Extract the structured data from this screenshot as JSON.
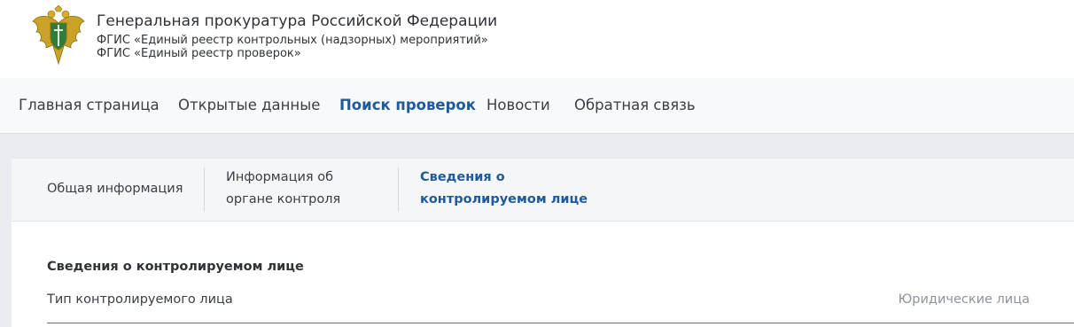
{
  "header": {
    "org_title": "Генеральная прокуратура Российской Федерации",
    "subtitle_1": "ФГИС «Единый реестр контрольных (надзорных) мероприятий»",
    "subtitle_2": "ФГИС «Единый реестр проверок»",
    "emblem_icon": "prosecutor-emblem-icon"
  },
  "nav": {
    "items": [
      {
        "label": "Главная страница",
        "active": false
      },
      {
        "label": "Открытые данные",
        "active": false
      },
      {
        "label": "Поиск проверок",
        "active": true
      },
      {
        "label": "Новости",
        "active": false
      },
      {
        "label": "Обратная связь",
        "active": false
      }
    ]
  },
  "tabs": {
    "items": [
      {
        "line1": "Общая информация",
        "line2": "",
        "active": false
      },
      {
        "line1": "Информация об",
        "line2": "органе контроля",
        "active": false
      },
      {
        "line1": "Сведения о",
        "line2": "контролируемом лице",
        "active": true
      }
    ]
  },
  "section": {
    "title": "Сведения о контролируемом лице",
    "rows": [
      {
        "label": "Тип контролируемого лица",
        "value": "Юридические лица"
      }
    ]
  },
  "colors": {
    "accent": "#1f5a9c",
    "text": "#3a3f45",
    "muted": "#8c939b",
    "page_bg": "#e9ecf0"
  }
}
